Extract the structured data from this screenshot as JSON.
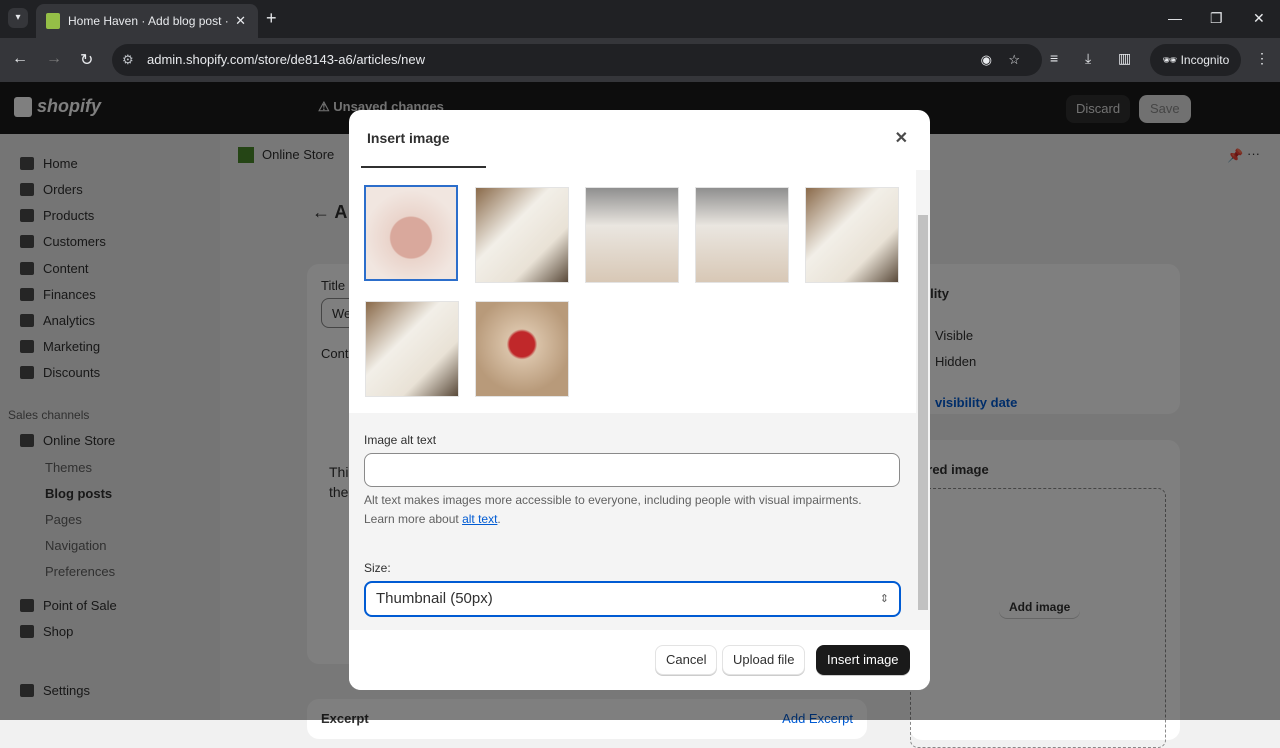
{
  "browser": {
    "tab_title": "Home Haven · Add blog post · Shopify",
    "url": "admin.shopify.com/store/de8143-a6/articles/new",
    "profile": "Incognito"
  },
  "topbar": {
    "brand": "shopify",
    "status": "Unsaved changes",
    "discard": "Discard",
    "save": "Save"
  },
  "sidebar": {
    "items": [
      {
        "label": "Home"
      },
      {
        "label": "Orders"
      },
      {
        "label": "Products"
      },
      {
        "label": "Customers"
      },
      {
        "label": "Content"
      },
      {
        "label": "Finances"
      },
      {
        "label": "Analytics"
      },
      {
        "label": "Marketing"
      },
      {
        "label": "Discounts"
      }
    ],
    "sales_channels": "Sales channels",
    "channel": "Online Store",
    "sub_items": [
      {
        "label": "Themes"
      },
      {
        "label": "Blog posts"
      },
      {
        "label": "Pages"
      },
      {
        "label": "Navigation"
      },
      {
        "label": "Preferences"
      }
    ],
    "apps": [
      {
        "label": "Point of Sale"
      },
      {
        "label": "Shop"
      }
    ],
    "settings": "Settings"
  },
  "main": {
    "breadcrumb": "Online Store",
    "title_initial": "A",
    "title_label": "Title",
    "title_value": "We",
    "content_label": "Cont",
    "content_text": "Thi",
    "content_text2": "the",
    "visibility": "ibility",
    "visible": "Visible",
    "hidden": "Hidden",
    "visibility_date": "visibility date",
    "featured": "tured image",
    "add_image": "Add image",
    "excerpt": "Excerpt",
    "add_excerpt": "Add Excerpt"
  },
  "modal": {
    "title": "Insert image",
    "alt_label": "Image alt text",
    "alt_value": "",
    "help_text": "Alt text makes images more accessible to everyone, including people with visual impairments. Learn more about ",
    "help_link": "alt text",
    "size_label": "Size:",
    "size_value": "Thumbnail (50px)",
    "cancel": "Cancel",
    "upload": "Upload file",
    "insert": "Insert image",
    "images": [
      {
        "desc": "pink mug",
        "selected": true
      },
      {
        "desc": "white mugs"
      },
      {
        "desc": "mugs with plant"
      },
      {
        "desc": "mugs with plant"
      },
      {
        "desc": "white mugs"
      },
      {
        "desc": "white mugs"
      },
      {
        "desc": "red gift box"
      }
    ]
  },
  "colors": {
    "accent": "#005bd3",
    "primary_button": "#1a1a1a",
    "selected_border": "#2c6ecb"
  }
}
